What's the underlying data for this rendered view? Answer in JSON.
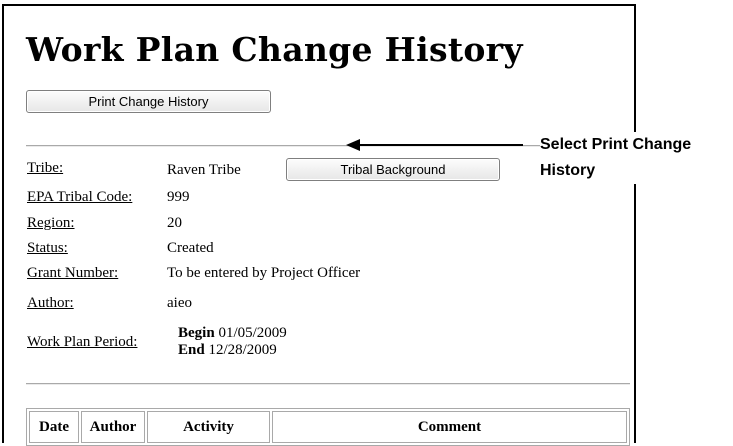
{
  "page_title": "Work Plan Change History",
  "buttons": {
    "print_change_history": "Print Change History",
    "tribal_background": "Tribal Background"
  },
  "callout": {
    "line1": "Select Print Change",
    "line2": "History"
  },
  "fields": {
    "tribe": {
      "label": "Tribe:",
      "value": "Raven Tribe"
    },
    "epa_code": {
      "label": "EPA Tribal Code:",
      "value": "999"
    },
    "region": {
      "label": "Region:",
      "value": "20"
    },
    "status": {
      "label": "Status:",
      "value": "Created"
    },
    "grant_number": {
      "label": "Grant Number:",
      "value": "To be entered by Project Officer"
    },
    "author": {
      "label": "Author:",
      "value": "aieo"
    },
    "work_plan_period": {
      "label": "Work Plan Period:",
      "begin_label": "Begin",
      "begin_value": "01/05/2009",
      "end_label": "End",
      "end_value": "12/28/2009"
    }
  },
  "history_table": {
    "columns": [
      "Date",
      "Author",
      "Activity",
      "Comment"
    ]
  }
}
